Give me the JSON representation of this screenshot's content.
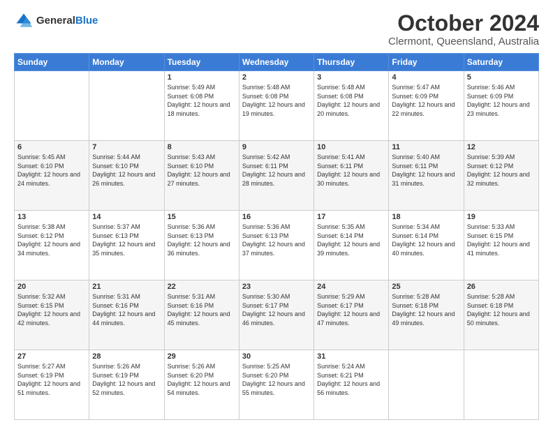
{
  "header": {
    "logo_general": "General",
    "logo_blue": "Blue",
    "month": "October 2024",
    "location": "Clermont, Queensland, Australia"
  },
  "days_of_week": [
    "Sunday",
    "Monday",
    "Tuesday",
    "Wednesday",
    "Thursday",
    "Friday",
    "Saturday"
  ],
  "weeks": [
    [
      {
        "day": "",
        "info": ""
      },
      {
        "day": "",
        "info": ""
      },
      {
        "day": "1",
        "info": "Sunrise: 5:49 AM\nSunset: 6:08 PM\nDaylight: 12 hours and 18 minutes."
      },
      {
        "day": "2",
        "info": "Sunrise: 5:48 AM\nSunset: 6:08 PM\nDaylight: 12 hours and 19 minutes."
      },
      {
        "day": "3",
        "info": "Sunrise: 5:48 AM\nSunset: 6:08 PM\nDaylight: 12 hours and 20 minutes."
      },
      {
        "day": "4",
        "info": "Sunrise: 5:47 AM\nSunset: 6:09 PM\nDaylight: 12 hours and 22 minutes."
      },
      {
        "day": "5",
        "info": "Sunrise: 5:46 AM\nSunset: 6:09 PM\nDaylight: 12 hours and 23 minutes."
      }
    ],
    [
      {
        "day": "6",
        "info": "Sunrise: 5:45 AM\nSunset: 6:10 PM\nDaylight: 12 hours and 24 minutes."
      },
      {
        "day": "7",
        "info": "Sunrise: 5:44 AM\nSunset: 6:10 PM\nDaylight: 12 hours and 26 minutes."
      },
      {
        "day": "8",
        "info": "Sunrise: 5:43 AM\nSunset: 6:10 PM\nDaylight: 12 hours and 27 minutes."
      },
      {
        "day": "9",
        "info": "Sunrise: 5:42 AM\nSunset: 6:11 PM\nDaylight: 12 hours and 28 minutes."
      },
      {
        "day": "10",
        "info": "Sunrise: 5:41 AM\nSunset: 6:11 PM\nDaylight: 12 hours and 30 minutes."
      },
      {
        "day": "11",
        "info": "Sunrise: 5:40 AM\nSunset: 6:11 PM\nDaylight: 12 hours and 31 minutes."
      },
      {
        "day": "12",
        "info": "Sunrise: 5:39 AM\nSunset: 6:12 PM\nDaylight: 12 hours and 32 minutes."
      }
    ],
    [
      {
        "day": "13",
        "info": "Sunrise: 5:38 AM\nSunset: 6:12 PM\nDaylight: 12 hours and 34 minutes."
      },
      {
        "day": "14",
        "info": "Sunrise: 5:37 AM\nSunset: 6:13 PM\nDaylight: 12 hours and 35 minutes."
      },
      {
        "day": "15",
        "info": "Sunrise: 5:36 AM\nSunset: 6:13 PM\nDaylight: 12 hours and 36 minutes."
      },
      {
        "day": "16",
        "info": "Sunrise: 5:36 AM\nSunset: 6:13 PM\nDaylight: 12 hours and 37 minutes."
      },
      {
        "day": "17",
        "info": "Sunrise: 5:35 AM\nSunset: 6:14 PM\nDaylight: 12 hours and 39 minutes."
      },
      {
        "day": "18",
        "info": "Sunrise: 5:34 AM\nSunset: 6:14 PM\nDaylight: 12 hours and 40 minutes."
      },
      {
        "day": "19",
        "info": "Sunrise: 5:33 AM\nSunset: 6:15 PM\nDaylight: 12 hours and 41 minutes."
      }
    ],
    [
      {
        "day": "20",
        "info": "Sunrise: 5:32 AM\nSunset: 6:15 PM\nDaylight: 12 hours and 42 minutes."
      },
      {
        "day": "21",
        "info": "Sunrise: 5:31 AM\nSunset: 6:16 PM\nDaylight: 12 hours and 44 minutes."
      },
      {
        "day": "22",
        "info": "Sunrise: 5:31 AM\nSunset: 6:16 PM\nDaylight: 12 hours and 45 minutes."
      },
      {
        "day": "23",
        "info": "Sunrise: 5:30 AM\nSunset: 6:17 PM\nDaylight: 12 hours and 46 minutes."
      },
      {
        "day": "24",
        "info": "Sunrise: 5:29 AM\nSunset: 6:17 PM\nDaylight: 12 hours and 47 minutes."
      },
      {
        "day": "25",
        "info": "Sunrise: 5:28 AM\nSunset: 6:18 PM\nDaylight: 12 hours and 49 minutes."
      },
      {
        "day": "26",
        "info": "Sunrise: 5:28 AM\nSunset: 6:18 PM\nDaylight: 12 hours and 50 minutes."
      }
    ],
    [
      {
        "day": "27",
        "info": "Sunrise: 5:27 AM\nSunset: 6:19 PM\nDaylight: 12 hours and 51 minutes."
      },
      {
        "day": "28",
        "info": "Sunrise: 5:26 AM\nSunset: 6:19 PM\nDaylight: 12 hours and 52 minutes."
      },
      {
        "day": "29",
        "info": "Sunrise: 5:26 AM\nSunset: 6:20 PM\nDaylight: 12 hours and 54 minutes."
      },
      {
        "day": "30",
        "info": "Sunrise: 5:25 AM\nSunset: 6:20 PM\nDaylight: 12 hours and 55 minutes."
      },
      {
        "day": "31",
        "info": "Sunrise: 5:24 AM\nSunset: 6:21 PM\nDaylight: 12 hours and 56 minutes."
      },
      {
        "day": "",
        "info": ""
      },
      {
        "day": "",
        "info": ""
      }
    ]
  ]
}
